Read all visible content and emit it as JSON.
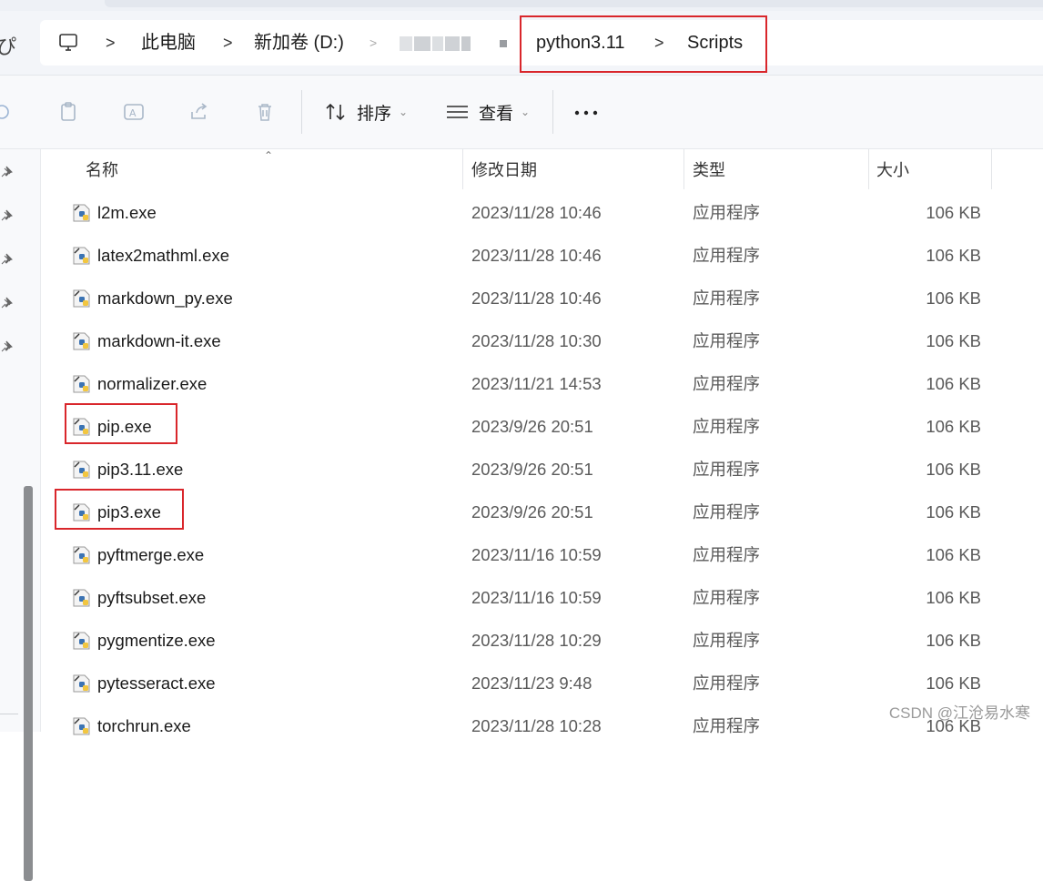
{
  "address_bar": {
    "left_edge_glyph": "ぴ",
    "pc_icon": "pc-icon",
    "separator": ">",
    "crumbs": [
      "此电脑",
      "新加卷 (D:)",
      "python3.11",
      "Scripts"
    ],
    "highlight_color": "#d9262b"
  },
  "toolbar": {
    "icons": [
      "cut-icon",
      "copy-icon",
      "rename-icon",
      "share-icon",
      "delete-icon"
    ],
    "sort_label": "排序",
    "view_label": "查看",
    "more_label": "..."
  },
  "columns": {
    "name": "名称",
    "modified": "修改日期",
    "type": "类型",
    "size": "大小"
  },
  "files": [
    {
      "name": "l2m.exe",
      "modified": "2023/11/28 10:46",
      "type": "应用程序",
      "size": "106 KB",
      "highlighted": false
    },
    {
      "name": "latex2mathml.exe",
      "modified": "2023/11/28 10:46",
      "type": "应用程序",
      "size": "106 KB",
      "highlighted": false
    },
    {
      "name": "markdown_py.exe",
      "modified": "2023/11/28 10:46",
      "type": "应用程序",
      "size": "106 KB",
      "highlighted": false
    },
    {
      "name": "markdown-it.exe",
      "modified": "2023/11/28 10:30",
      "type": "应用程序",
      "size": "106 KB",
      "highlighted": false
    },
    {
      "name": "normalizer.exe",
      "modified": "2023/11/21 14:53",
      "type": "应用程序",
      "size": "106 KB",
      "highlighted": false
    },
    {
      "name": "pip.exe",
      "modified": "2023/9/26 20:51",
      "type": "应用程序",
      "size": "106 KB",
      "highlighted": true
    },
    {
      "name": "pip3.11.exe",
      "modified": "2023/9/26 20:51",
      "type": "应用程序",
      "size": "106 KB",
      "highlighted": false
    },
    {
      "name": "pip3.exe",
      "modified": "2023/9/26 20:51",
      "type": "应用程序",
      "size": "106 KB",
      "highlighted": true
    },
    {
      "name": "pyftmerge.exe",
      "modified": "2023/11/16 10:59",
      "type": "应用程序",
      "size": "106 KB",
      "highlighted": false
    },
    {
      "name": "pyftsubset.exe",
      "modified": "2023/11/16 10:59",
      "type": "应用程序",
      "size": "106 KB",
      "highlighted": false
    },
    {
      "name": "pygmentize.exe",
      "modified": "2023/11/28 10:29",
      "type": "应用程序",
      "size": "106 KB",
      "highlighted": false
    },
    {
      "name": "pytesseract.exe",
      "modified": "2023/11/23 9:48",
      "type": "应用程序",
      "size": "106 KB",
      "highlighted": false
    },
    {
      "name": "torchrun.exe",
      "modified": "2023/11/28 10:28",
      "type": "应用程序",
      "size": "106 KB",
      "highlighted": false
    }
  ],
  "watermark": "CSDN @江沧易水寒"
}
